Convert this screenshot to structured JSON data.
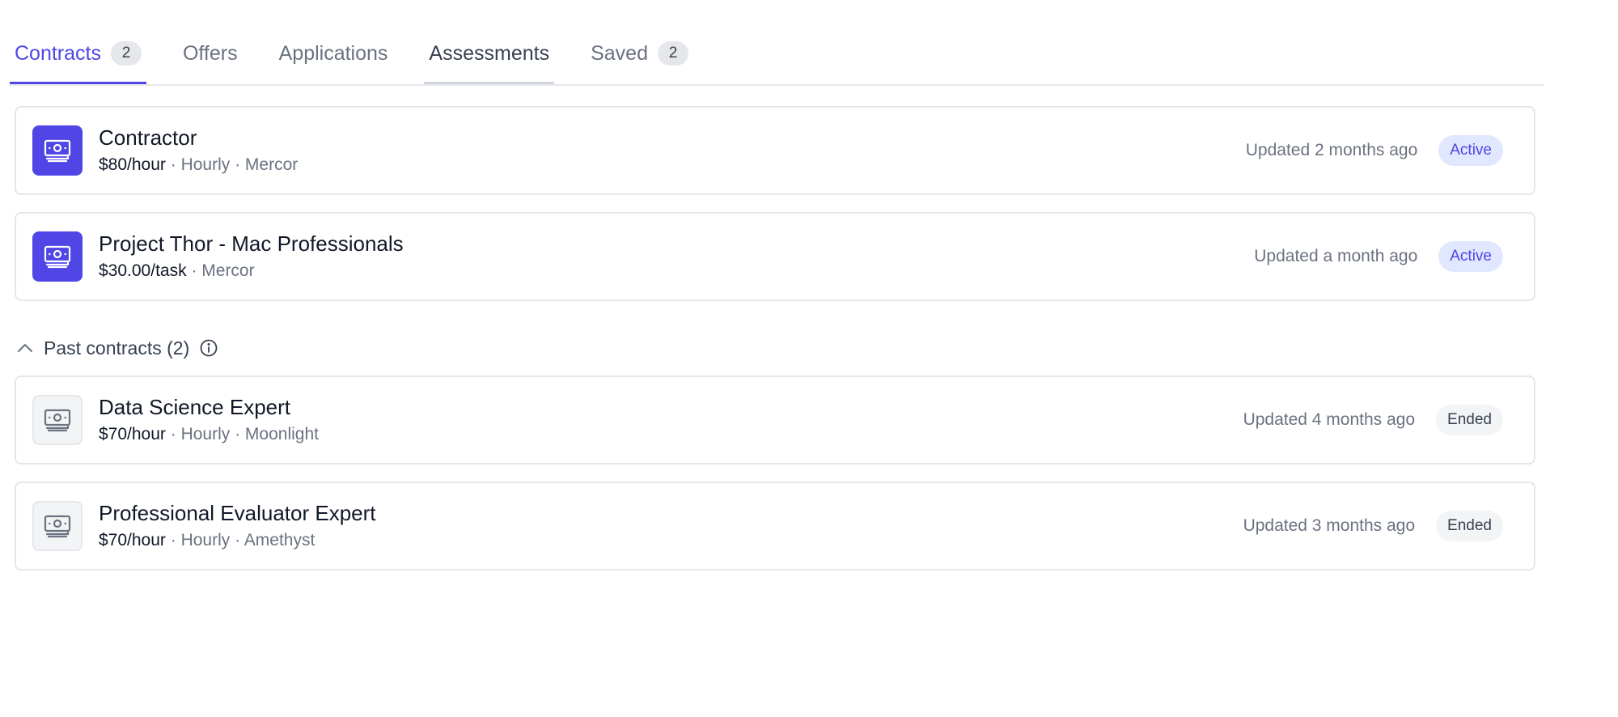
{
  "tabs": [
    {
      "label": "Contracts",
      "count": "2"
    },
    {
      "label": "Offers"
    },
    {
      "label": "Applications"
    },
    {
      "label": "Assessments"
    },
    {
      "label": "Saved",
      "count": "2"
    }
  ],
  "active_contracts": [
    {
      "title": "Contractor",
      "rate": "$80/hour",
      "meta": "· Hourly · Mercor",
      "updated": "Updated 2 months ago",
      "status": "Active"
    },
    {
      "title": "Project Thor - Mac Professionals",
      "rate": "$30.00/task",
      "meta": "· Mercor",
      "updated": "Updated a month ago",
      "status": "Active"
    }
  ],
  "past_section": {
    "label": "Past contracts (2)"
  },
  "past_contracts": [
    {
      "title": "Data Science Expert",
      "rate": "$70/hour",
      "meta": "· Hourly · Moonlight",
      "updated": "Updated 4 months ago",
      "status": "Ended"
    },
    {
      "title": "Professional Evaluator Expert",
      "rate": "$70/hour",
      "meta": "· Hourly · Amethyst",
      "updated": "Updated 3 months ago",
      "status": "Ended"
    }
  ],
  "icons": {
    "contract": "money-icon",
    "collapse": "chevron-up-icon",
    "info": "info-icon"
  },
  "colors": {
    "accent": "#4f46e5",
    "active_badge_bg": "#e0e7ff",
    "ended_badge_bg": "#f3f4f6"
  }
}
